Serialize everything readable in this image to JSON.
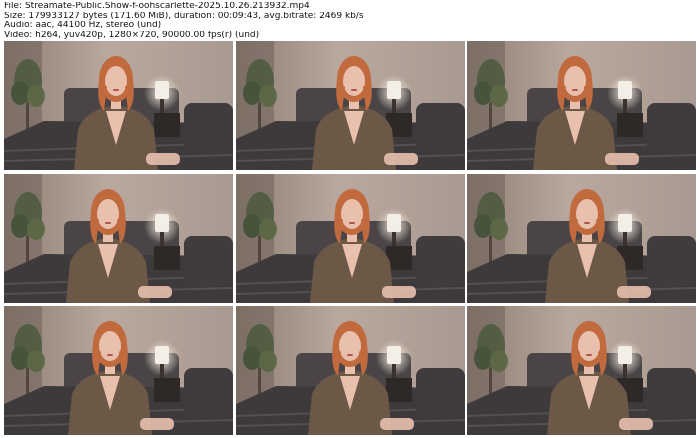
{
  "info": {
    "file_line": "File: Streamate-Public.Show-f-oohscarlette-2025.10.26.213932.mp4",
    "size_line": "Size: 179933127 bytes (171.60 MiB), duration: 00:09:43, avg.bitrate: 2469 kb/s",
    "audio_line": "Audio: aac, 44100 Hz, stereo (und)",
    "video_line": "Video: h264, yuv420p, 1280×720, 90000.00 fps(r) (und)"
  },
  "thumbnails": [
    {
      "index": 1
    },
    {
      "index": 2
    },
    {
      "index": 3
    },
    {
      "index": 4
    },
    {
      "index": 5
    },
    {
      "index": 6
    },
    {
      "index": 7
    },
    {
      "index": 8
    },
    {
      "index": 9
    }
  ],
  "colors": {
    "wall": "#b9a89e",
    "wall_dark": "#8f7e74",
    "bed": "#3e3a3c",
    "hair": "#c06a3e",
    "jacket": "#6b5847",
    "skin": "#e8c0ad",
    "lamp": "#f4efe6"
  }
}
